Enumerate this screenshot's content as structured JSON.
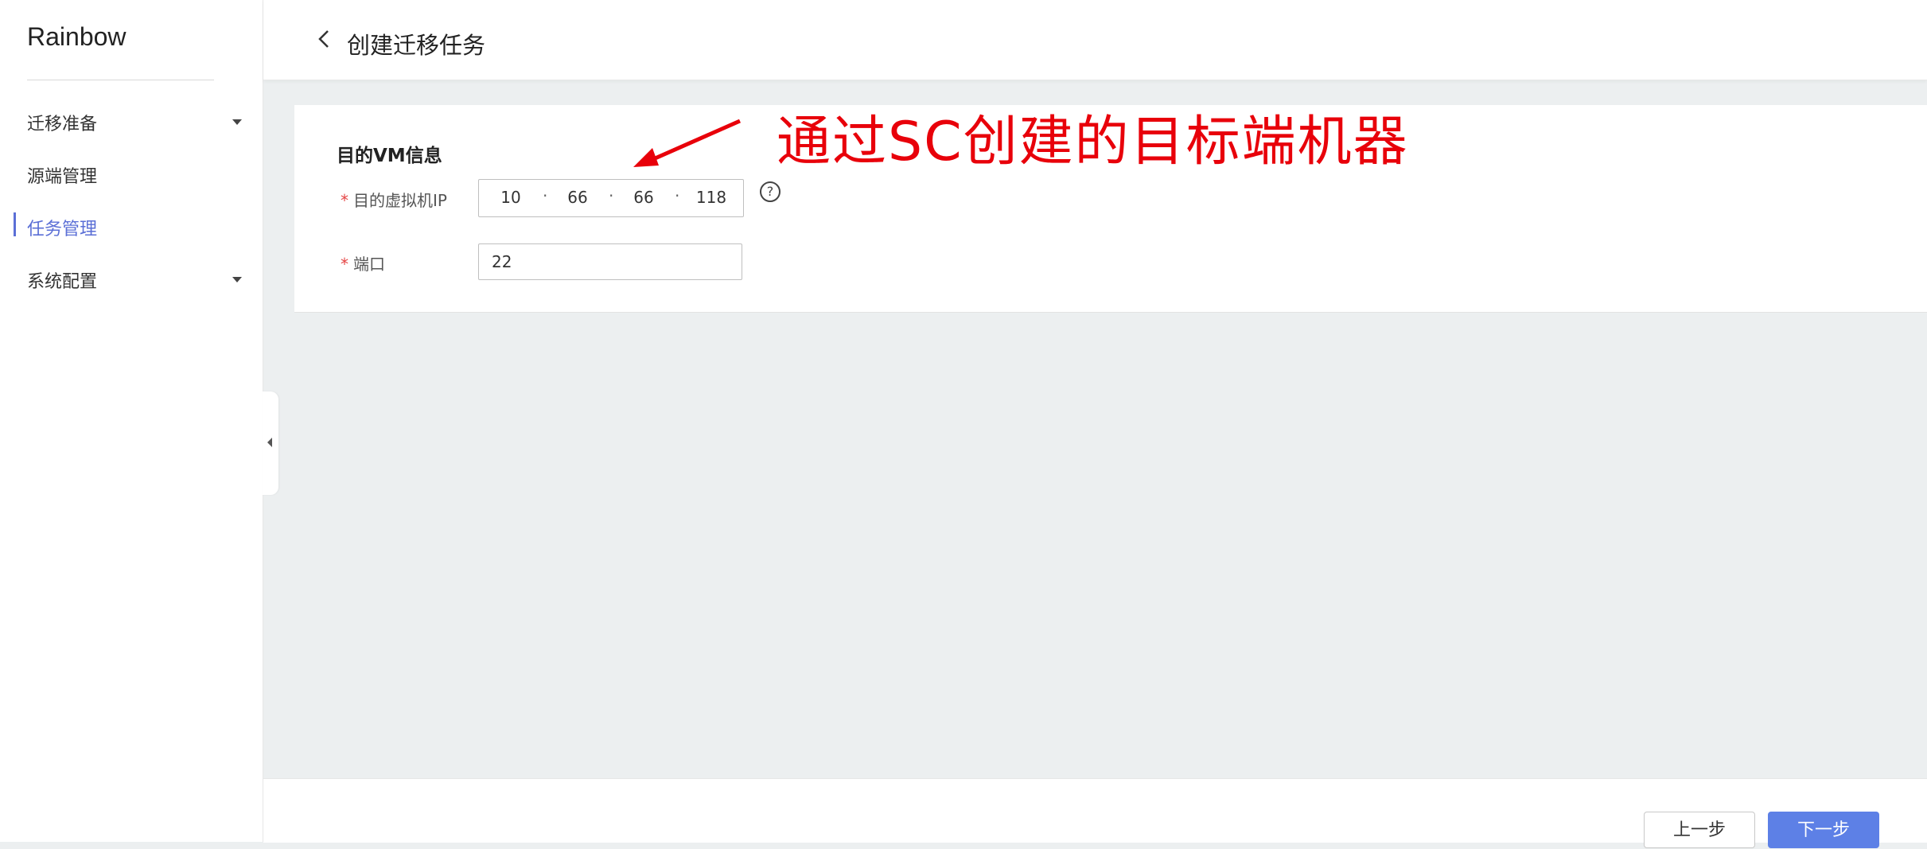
{
  "sidebar": {
    "brand": "Rainbow",
    "items": [
      {
        "label": "迁移准备",
        "expandable": true,
        "active": false
      },
      {
        "label": "源端管理",
        "expandable": false,
        "active": false
      },
      {
        "label": "任务管理",
        "expandable": false,
        "active": true
      },
      {
        "label": "系统配置",
        "expandable": true,
        "active": false
      }
    ]
  },
  "header": {
    "title": "创建迁移任务"
  },
  "form": {
    "section_title": "目的VM信息",
    "target_ip": {
      "label": "目的虚拟机IP",
      "required": true,
      "segments": [
        "10",
        "66",
        "66",
        "118"
      ]
    },
    "port": {
      "label": "端口",
      "required": true,
      "value": "22"
    }
  },
  "annotation": {
    "text": "通过SC创建的目标端机器",
    "color": "#e8000a"
  },
  "footer": {
    "prev_label": "上一步",
    "next_label": "下一步"
  },
  "colors": {
    "accent": "#5b6fd6",
    "primary_button": "#5d80e6",
    "required_star": "#e54545"
  }
}
